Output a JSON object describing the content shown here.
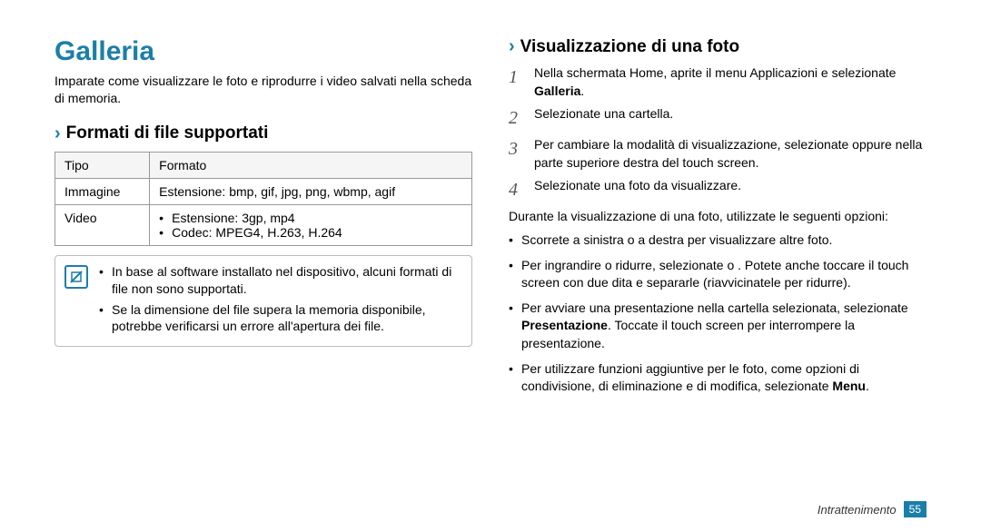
{
  "left": {
    "main_title": "Galleria",
    "intro": "Imparate come visualizzare le foto e riprodurre i video salvati nella scheda di memoria.",
    "section1": {
      "chevron": "›",
      "title": "Formati di file supportati"
    },
    "table": {
      "hdr_type": "Tipo",
      "hdr_format": "Formato",
      "row1_type": "Immagine",
      "row1_format": "Estensione: bmp, gif, jpg, png, wbmp, agif",
      "row2_type": "Video",
      "row2_ext": "Estensione: 3gp, mp4",
      "row2_codec": "Codec: MPEG4, H.263, H.264"
    },
    "note": {
      "icon_label": "⊘",
      "item1": "In base al software installato nel dispositivo, alcuni formati di file non sono supportati.",
      "item2": "Se la dimensione del file supera la memoria disponibile, potrebbe verificarsi un errore all'apertura dei file."
    }
  },
  "right": {
    "section2": {
      "chevron": "›",
      "title": "Visualizzazione di una foto"
    },
    "steps": {
      "s1_num": "1",
      "s1_a": "Nella schermata Home, aprite il menu Applicazioni e selezionate ",
      "s1_b": "Galleria",
      "s1_c": ".",
      "s2_num": "2",
      "s2": "Selezionate una cartella.",
      "s3_num": "3",
      "s3": "Per cambiare la modalità di visualizzazione, selezionate      oppure      nella parte superiore destra del touch screen.",
      "s4_num": "4",
      "s4": "Selezionate una foto da visualizzare."
    },
    "para": "Durante la visualizzazione di una foto, utilizzate le seguenti opzioni:",
    "opts": {
      "o1": "Scorrete a sinistra o a destra per visualizzare altre foto.",
      "o2": "Per ingrandire o ridurre, selezionate      o     . Potete anche toccare il touch screen con due dita e separarle (riavvicinatele per ridurre).",
      "o3a": "Per avviare una presentazione nella cartella selezionata, selezionate ",
      "o3b": "Presentazione",
      "o3c": ". Toccate il touch screen per interrompere la presentazione.",
      "o4a": "Per utilizzare funzioni aggiuntive per le foto, come opzioni di condivisione, di eliminazione e di modifica, selezionate ",
      "o4b": "Menu",
      "o4c": "."
    }
  },
  "footer": {
    "section": "Intrattenimento",
    "page": "55"
  }
}
